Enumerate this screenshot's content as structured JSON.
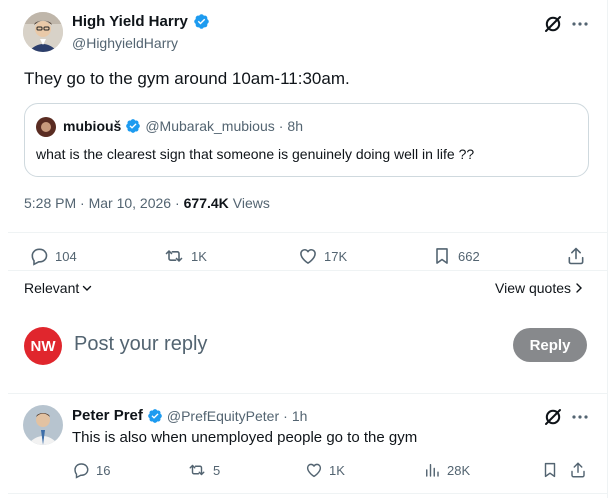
{
  "post": {
    "author_name": "High Yield Harry",
    "author_handle": "@HighyieldHarry",
    "text": "They go to the gym around 10am-11:30am.",
    "quote": {
      "author_name": "mubiouš",
      "author_handle": "@Mubarak_mubious",
      "separator": "·",
      "time_ago": "8h",
      "text": "what is the clearest sign that someone is genuinely doing well in life ??"
    },
    "timestamp": "5:28 PM · Mar 10, 2026 ·",
    "views_count": "677.4K",
    "views_label": "Views",
    "stats": {
      "replies": "104",
      "reposts": "1K",
      "likes": "17K",
      "bookmarks": "662"
    },
    "relevant_label": "Relevant",
    "view_quotes_label": "View quotes"
  },
  "reply_box": {
    "avatar_text": "NW",
    "avatar_color": "#e0262d",
    "placeholder": "Post your reply",
    "button_label": "Reply"
  },
  "reply": {
    "author_name": "Peter Pref",
    "author_handle": "@PrefEquityPeter",
    "separator": "·",
    "time_ago": "1h",
    "text": "This is also when unemployed people go to the gym",
    "stats": {
      "replies": "16",
      "reposts": "5",
      "likes": "1K",
      "views": "28K"
    }
  },
  "colors": {
    "accent": "#1d9bf0",
    "text": "#0f1419",
    "muted": "#536471",
    "reply_button": "#87898c"
  }
}
